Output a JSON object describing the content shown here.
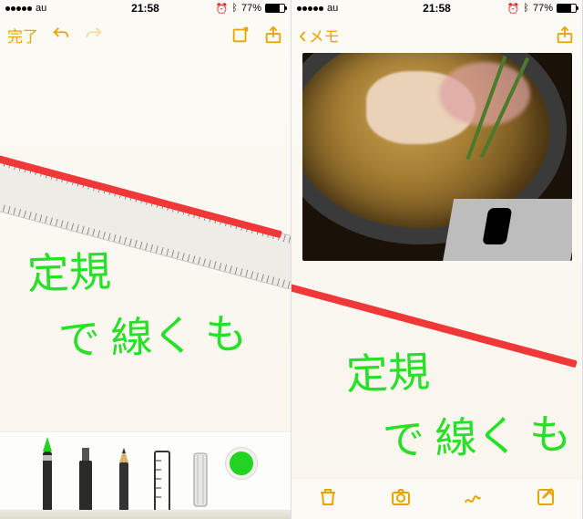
{
  "status": {
    "carrier": "au",
    "time": "21:58",
    "battery_pct": "77%"
  },
  "left": {
    "nav": {
      "done": "完了"
    },
    "hand1": "定規",
    "hand2": "で 線く も"
  },
  "right": {
    "nav": {
      "back": "メモ"
    },
    "hand1": "定規",
    "hand2": "で 線く も"
  },
  "colors": {
    "accent": "#e9a400",
    "ink": "#28e028",
    "line": "#f03838"
  }
}
